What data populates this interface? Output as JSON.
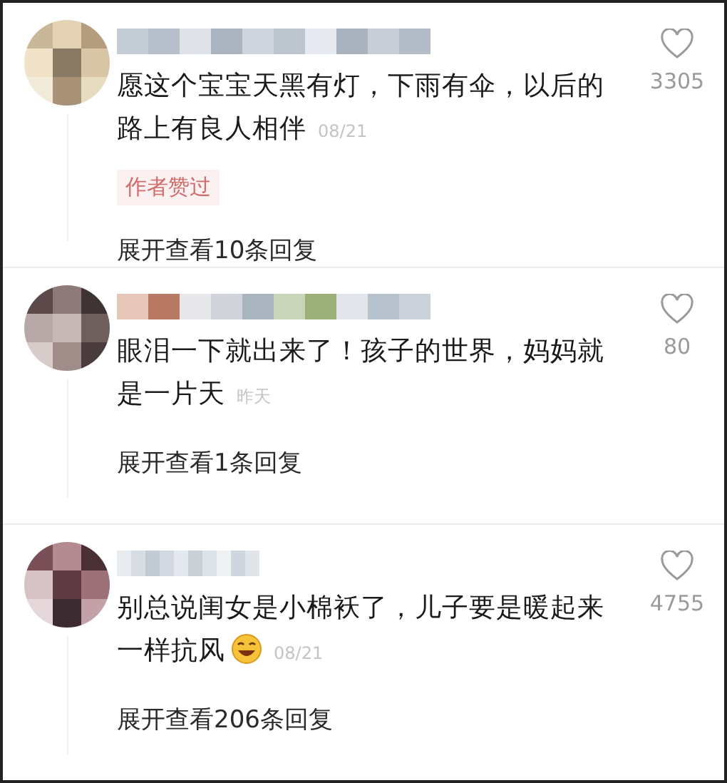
{
  "comments": [
    {
      "text": "愿这个宝宝天黑有灯，下雨有伞，以后的路上有良人相伴",
      "emoji": false,
      "time": "08/21",
      "badge": "作者赞过",
      "likes": "3305",
      "liked": false,
      "replies": "展开查看10条回复"
    },
    {
      "text": "眼泪一下就出来了！孩子的世界，妈妈就是一片天",
      "emoji": false,
      "time": "昨天",
      "likes": "80",
      "liked": false,
      "replies": "展开查看1条回复"
    },
    {
      "text": "别总说闺女是小棉袄了，儿子要是暖起来一样抗风",
      "emoji": true,
      "time": "08/21",
      "likes": "4755",
      "liked": false,
      "replies": "展开查看206条回复"
    }
  ]
}
